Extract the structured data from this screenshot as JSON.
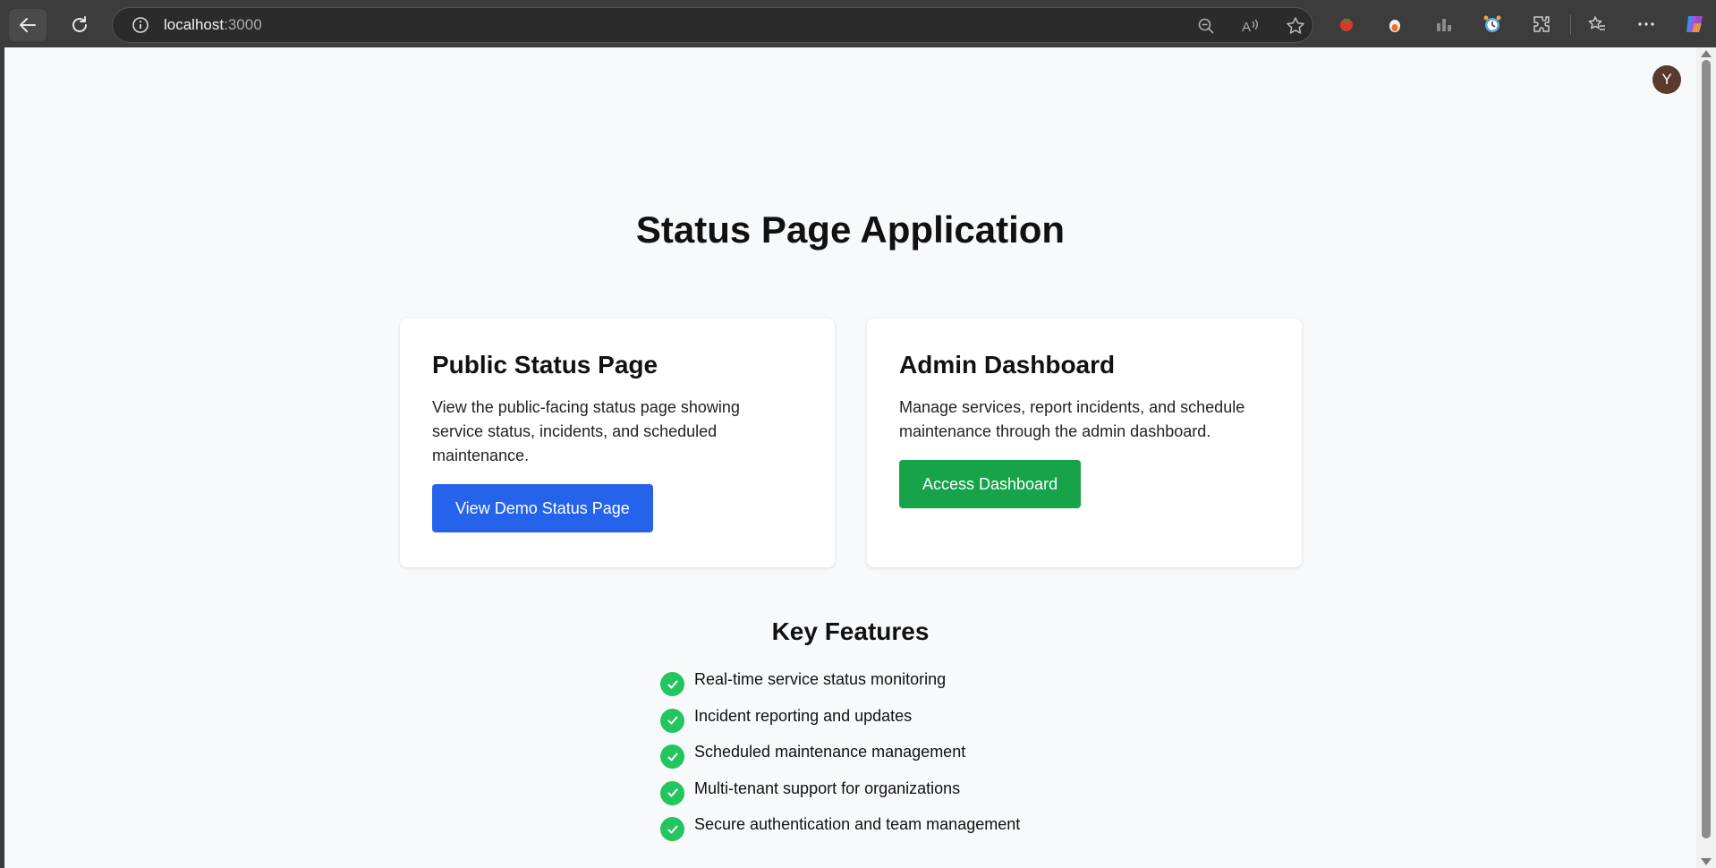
{
  "browser": {
    "url_host": "localhost",
    "url_port": ":3000"
  },
  "user": {
    "avatar_initial": "Y"
  },
  "page": {
    "title": "Status Page Application",
    "cards": [
      {
        "title": "Public Status Page",
        "description": "View the public-facing status page showing service status, incidents, and scheduled maintenance.",
        "button_label": "View Demo Status Page",
        "button_color": "#2563eb"
      },
      {
        "title": "Admin Dashboard",
        "description": "Manage services, report incidents, and schedule maintenance through the admin dashboard.",
        "button_label": "Access Dashboard",
        "button_color": "#16a34a"
      }
    ],
    "features_title": "Key Features",
    "features": [
      "Real-time service status monitoring",
      "Incident reporting and updates",
      "Scheduled maintenance management",
      "Multi-tenant support for organizations",
      "Secure authentication and team management"
    ],
    "check_color": "#22c55e"
  }
}
